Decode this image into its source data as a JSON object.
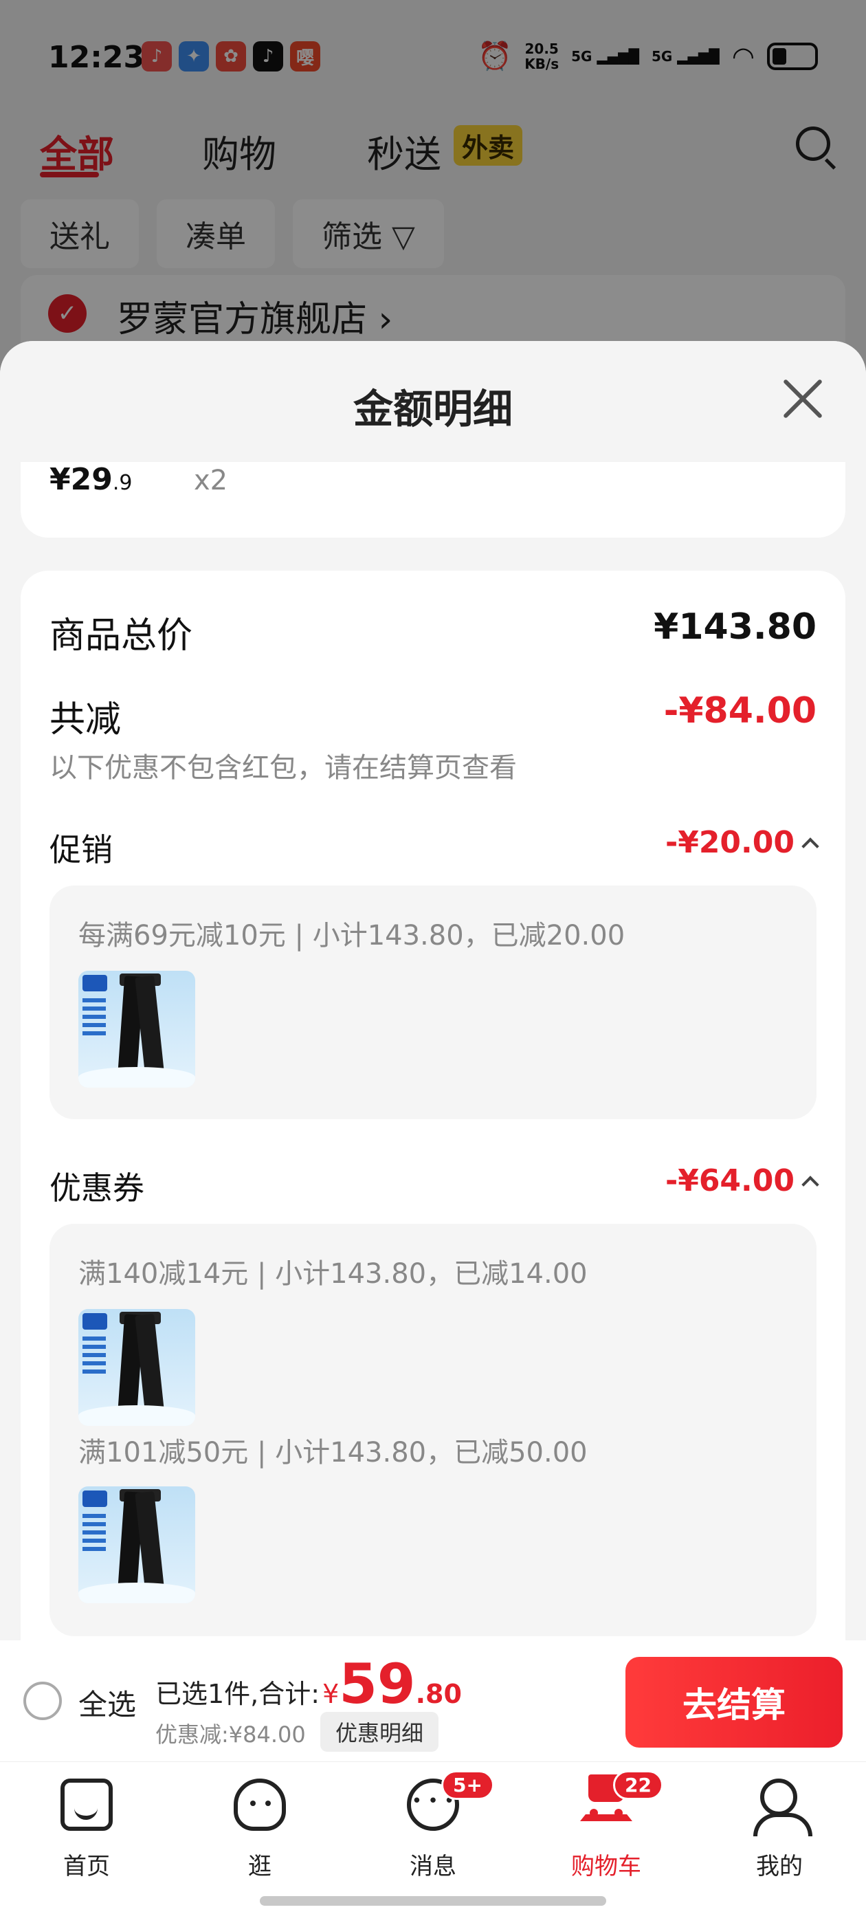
{
  "status_bar": {
    "time": "12:23",
    "net_speed_value": "20.5",
    "net_speed_unit": "KB/s",
    "signal1": "5G",
    "signal2": "5G",
    "apps": [
      {
        "glyph": "♪",
        "color": "#f0524f"
      },
      {
        "glyph": "✦",
        "color": "#3d8cf0"
      },
      {
        "glyph": "✿",
        "color": "#f04b3c"
      },
      {
        "glyph": "♪",
        "color": "#111111"
      },
      {
        "glyph": "嘤",
        "color": "#f04a2a"
      }
    ]
  },
  "tabs": [
    {
      "label": "全部",
      "active": true
    },
    {
      "label": "购物",
      "active": false
    },
    {
      "label": "秒送",
      "active": false
    }
  ],
  "tab_badge": "外卖",
  "chips": [
    "送礼",
    "凑单",
    "筛选 ▽"
  ],
  "store": {
    "name": "罗蒙官方旗舰店 ›"
  },
  "sheet": {
    "title": "金额明细",
    "item": {
      "price_main": "¥29",
      "price_decimal": ".9",
      "qty": "x2"
    },
    "total_label": "商品总价",
    "total_value": "¥143.80",
    "discount_label": "共减",
    "discount_value": "-¥84.00",
    "discount_note": "以下优惠不包含红包，请在结算页查看",
    "promo": {
      "label": "促销",
      "value": "-¥20.00",
      "rules": [
        "每满69元减10元 | 小计143.80，已减20.00"
      ]
    },
    "coupon": {
      "label": "优惠券",
      "value": "-¥64.00",
      "rules": [
        "满140减14元 | 小计143.80，已减14.00",
        "满101减50元 | 小计143.80，已减50.00"
      ]
    }
  },
  "checkout": {
    "select_all": "全选",
    "selected_text": "已选1件,合计:",
    "yen": "¥",
    "total_int": "59",
    "total_dec": ".80",
    "discount_text": "优惠减:¥84.00",
    "detail_button": "优惠明细",
    "checkout_button": "去结算"
  },
  "nav": [
    {
      "label": "首页",
      "icon": "home-icon"
    },
    {
      "label": "逛",
      "icon": "stroll-icon"
    },
    {
      "label": "消息",
      "icon": "message-icon",
      "badge": "5+"
    },
    {
      "label": "购物车",
      "icon": "cart-icon",
      "badge": "22",
      "active": true
    },
    {
      "label": "我的",
      "icon": "profile-icon"
    }
  ],
  "colors": {
    "accent": "#e4202b",
    "badge_yellow": "#f7d13a"
  }
}
